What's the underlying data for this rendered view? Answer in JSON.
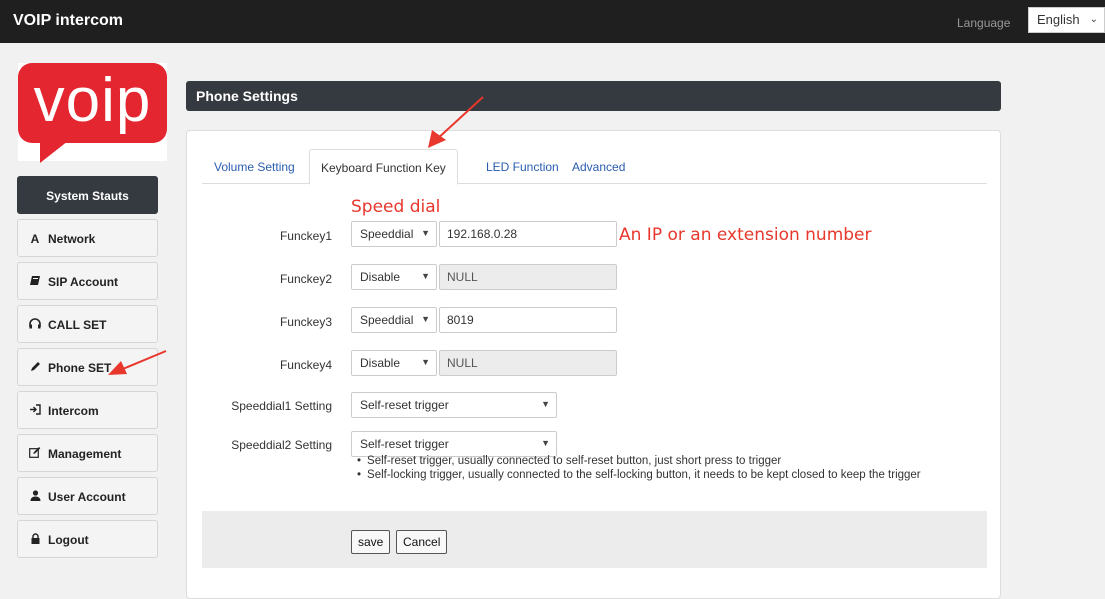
{
  "header": {
    "title": "VOIP intercom",
    "language_label": "Language",
    "language_value": "English"
  },
  "logo": {
    "text": "voip"
  },
  "sidebar": {
    "items": [
      {
        "label": "System Stauts",
        "icon": "none",
        "active": true
      },
      {
        "label": "Network",
        "icon": "a-icon"
      },
      {
        "label": "SIP Account",
        "icon": "book-icon"
      },
      {
        "label": "CALL SET",
        "icon": "headphones-icon"
      },
      {
        "label": "Phone SET",
        "icon": "pencil-icon"
      },
      {
        "label": "Intercom",
        "icon": "sign-in-icon"
      },
      {
        "label": "Management",
        "icon": "edit-icon"
      },
      {
        "label": "User Account",
        "icon": "user-icon"
      },
      {
        "label": "Logout",
        "icon": "lock-icon"
      }
    ]
  },
  "panel": {
    "title": "Phone Settings"
  },
  "tabs": [
    {
      "label": "Volume Setting",
      "active": false
    },
    {
      "label": "Keyboard Function Key",
      "active": true
    },
    {
      "label": "LED Function",
      "active": false
    },
    {
      "label": "Advanced",
      "active": false
    }
  ],
  "funckeys": [
    {
      "label": "Funckey1",
      "mode": "Speeddial",
      "value": "192.168.0.28",
      "disabled": false
    },
    {
      "label": "Funckey2",
      "mode": "Disable",
      "value": "NULL",
      "disabled": true
    },
    {
      "label": "Funckey3",
      "mode": "Speeddial",
      "value": "8019",
      "disabled": false
    },
    {
      "label": "Funckey4",
      "mode": "Disable",
      "value": "NULL",
      "disabled": true
    }
  ],
  "speeddial_settings": [
    {
      "label": "Speeddial1 Setting",
      "value": "Self-reset trigger"
    },
    {
      "label": "Speeddial2 Setting",
      "value": "Self-reset trigger"
    }
  ],
  "notes": [
    "Self-reset trigger, usually connected to self-reset button, just short press to trigger",
    "Self-locking trigger, usually connected to the self-locking button, it needs to be kept closed to keep the trigger"
  ],
  "buttons": {
    "save": "save",
    "cancel": "Cancel"
  },
  "annotations": {
    "speed_dial": "Speed dial",
    "ip_hint": "An IP or an extension number"
  },
  "colors": {
    "header_bg": "#1f1f1f",
    "nav_active": "#353a40",
    "annotation": "#e8372c",
    "logo_red": "#e3262f",
    "link_blue": "#2a5db0"
  }
}
